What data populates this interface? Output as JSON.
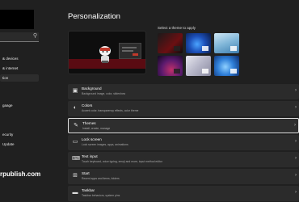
{
  "sidebar": {
    "search_icon": "search-icon",
    "items": [
      {
        "label": "& devices"
      },
      {
        "label": "& internet"
      },
      {
        "label": "tion"
      },
      {
        "label": "gaage"
      },
      {
        "label": "ecurity"
      },
      {
        "label": "Update"
      }
    ]
  },
  "watermark": "rpublish.com",
  "page_title": "Personalization",
  "themes_label": "Select a theme to apply",
  "rows": [
    {
      "title": "Background",
      "sub": "Background image, color, slideshow",
      "icon": "image-icon"
    },
    {
      "title": "Colors",
      "sub": "Accent color, transparency effects, color theme",
      "icon": "palette-icon"
    },
    {
      "title": "Themes",
      "sub": "Install, create, manage",
      "icon": "brush-icon"
    },
    {
      "title": "Lock screen",
      "sub": "Lock screen images, apps, animations",
      "icon": "lock-screen-icon"
    },
    {
      "title": "Text input",
      "sub": "Touch keyboard, voice typing, emoji and more, input method editor",
      "icon": "keyboard-icon"
    },
    {
      "title": "Start",
      "sub": "Recent apps and items, folders",
      "icon": "start-icon"
    },
    {
      "title": "Taskbar",
      "sub": "Taskbar behaviors, system pins",
      "icon": "taskbar-icon"
    }
  ],
  "active_row": "Themes",
  "chevron_icon": "chevron-right-icon"
}
